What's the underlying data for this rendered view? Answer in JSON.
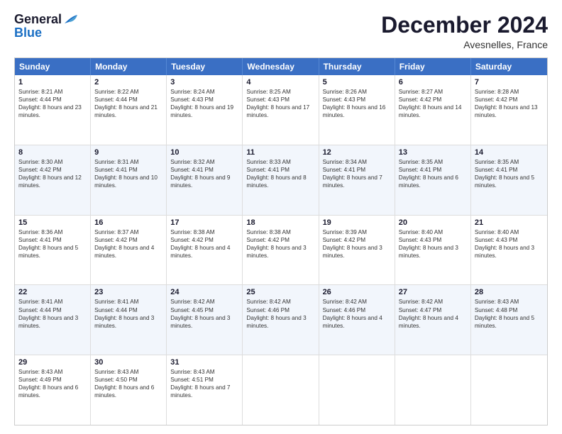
{
  "logo": {
    "general": "General",
    "blue": "Blue"
  },
  "title": "December 2024",
  "subtitle": "Avesnelles, France",
  "days": [
    "Sunday",
    "Monday",
    "Tuesday",
    "Wednesday",
    "Thursday",
    "Friday",
    "Saturday"
  ],
  "weeks": [
    [
      {
        "day": "1",
        "sunrise": "8:21 AM",
        "sunset": "4:44 PM",
        "daylight": "8 hours and 23 minutes."
      },
      {
        "day": "2",
        "sunrise": "8:22 AM",
        "sunset": "4:44 PM",
        "daylight": "8 hours and 21 minutes."
      },
      {
        "day": "3",
        "sunrise": "8:24 AM",
        "sunset": "4:43 PM",
        "daylight": "8 hours and 19 minutes."
      },
      {
        "day": "4",
        "sunrise": "8:25 AM",
        "sunset": "4:43 PM",
        "daylight": "8 hours and 17 minutes."
      },
      {
        "day": "5",
        "sunrise": "8:26 AM",
        "sunset": "4:43 PM",
        "daylight": "8 hours and 16 minutes."
      },
      {
        "day": "6",
        "sunrise": "8:27 AM",
        "sunset": "4:42 PM",
        "daylight": "8 hours and 14 minutes."
      },
      {
        "day": "7",
        "sunrise": "8:28 AM",
        "sunset": "4:42 PM",
        "daylight": "8 hours and 13 minutes."
      }
    ],
    [
      {
        "day": "8",
        "sunrise": "8:30 AM",
        "sunset": "4:42 PM",
        "daylight": "8 hours and 12 minutes."
      },
      {
        "day": "9",
        "sunrise": "8:31 AM",
        "sunset": "4:41 PM",
        "daylight": "8 hours and 10 minutes."
      },
      {
        "day": "10",
        "sunrise": "8:32 AM",
        "sunset": "4:41 PM",
        "daylight": "8 hours and 9 minutes."
      },
      {
        "day": "11",
        "sunrise": "8:33 AM",
        "sunset": "4:41 PM",
        "daylight": "8 hours and 8 minutes."
      },
      {
        "day": "12",
        "sunrise": "8:34 AM",
        "sunset": "4:41 PM",
        "daylight": "8 hours and 7 minutes."
      },
      {
        "day": "13",
        "sunrise": "8:35 AM",
        "sunset": "4:41 PM",
        "daylight": "8 hours and 6 minutes."
      },
      {
        "day": "14",
        "sunrise": "8:35 AM",
        "sunset": "4:41 PM",
        "daylight": "8 hours and 5 minutes."
      }
    ],
    [
      {
        "day": "15",
        "sunrise": "8:36 AM",
        "sunset": "4:41 PM",
        "daylight": "8 hours and 5 minutes."
      },
      {
        "day": "16",
        "sunrise": "8:37 AM",
        "sunset": "4:42 PM",
        "daylight": "8 hours and 4 minutes."
      },
      {
        "day": "17",
        "sunrise": "8:38 AM",
        "sunset": "4:42 PM",
        "daylight": "8 hours and 4 minutes."
      },
      {
        "day": "18",
        "sunrise": "8:38 AM",
        "sunset": "4:42 PM",
        "daylight": "8 hours and 3 minutes."
      },
      {
        "day": "19",
        "sunrise": "8:39 AM",
        "sunset": "4:42 PM",
        "daylight": "8 hours and 3 minutes."
      },
      {
        "day": "20",
        "sunrise": "8:40 AM",
        "sunset": "4:43 PM",
        "daylight": "8 hours and 3 minutes."
      },
      {
        "day": "21",
        "sunrise": "8:40 AM",
        "sunset": "4:43 PM",
        "daylight": "8 hours and 3 minutes."
      }
    ],
    [
      {
        "day": "22",
        "sunrise": "8:41 AM",
        "sunset": "4:44 PM",
        "daylight": "8 hours and 3 minutes."
      },
      {
        "day": "23",
        "sunrise": "8:41 AM",
        "sunset": "4:44 PM",
        "daylight": "8 hours and 3 minutes."
      },
      {
        "day": "24",
        "sunrise": "8:42 AM",
        "sunset": "4:45 PM",
        "daylight": "8 hours and 3 minutes."
      },
      {
        "day": "25",
        "sunrise": "8:42 AM",
        "sunset": "4:46 PM",
        "daylight": "8 hours and 3 minutes."
      },
      {
        "day": "26",
        "sunrise": "8:42 AM",
        "sunset": "4:46 PM",
        "daylight": "8 hours and 4 minutes."
      },
      {
        "day": "27",
        "sunrise": "8:42 AM",
        "sunset": "4:47 PM",
        "daylight": "8 hours and 4 minutes."
      },
      {
        "day": "28",
        "sunrise": "8:43 AM",
        "sunset": "4:48 PM",
        "daylight": "8 hours and 5 minutes."
      }
    ],
    [
      {
        "day": "29",
        "sunrise": "8:43 AM",
        "sunset": "4:49 PM",
        "daylight": "8 hours and 6 minutes."
      },
      {
        "day": "30",
        "sunrise": "8:43 AM",
        "sunset": "4:50 PM",
        "daylight": "8 hours and 6 minutes."
      },
      {
        "day": "31",
        "sunrise": "8:43 AM",
        "sunset": "4:51 PM",
        "daylight": "8 hours and 7 minutes."
      },
      null,
      null,
      null,
      null
    ]
  ]
}
